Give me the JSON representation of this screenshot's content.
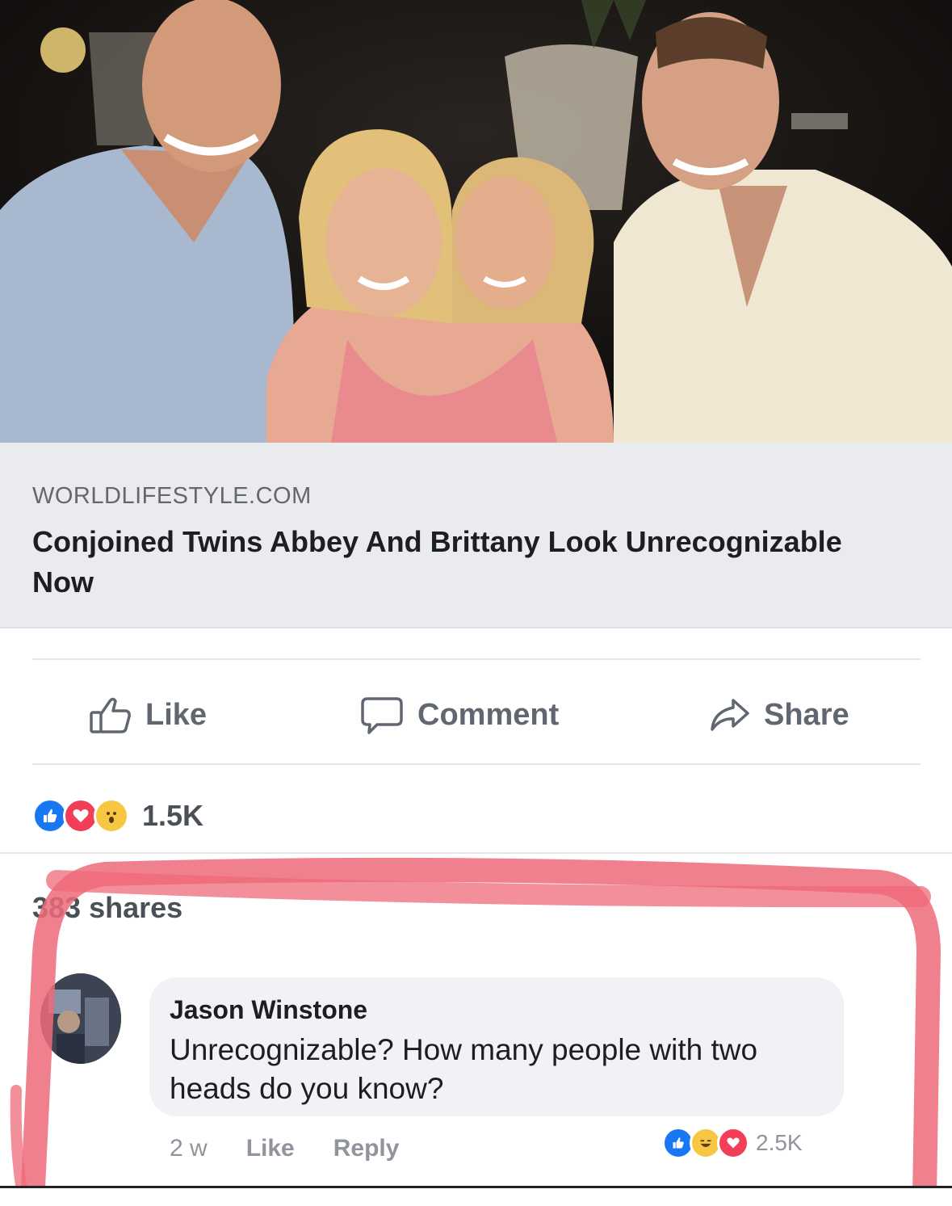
{
  "post": {
    "photo_icon": "group-photo",
    "link_domain": "WORLDLIFESTYLE.COM",
    "link_headline": "Conjoined Twins Abbey And Brittany Look Unrecognizable Now"
  },
  "actions": {
    "like_label": "Like",
    "comment_label": "Comment",
    "share_label": "Share"
  },
  "reactions": {
    "icons": [
      "like-reaction-icon",
      "love-reaction-icon",
      "wow-reaction-icon"
    ],
    "count": "1.5K"
  },
  "shares_text": "383 shares",
  "comment": {
    "author": "Jason Winstone",
    "text": "Unrecognizable? How many people with two heads do you know?",
    "age": "2 w",
    "like_label": "Like",
    "reply_label": "Reply",
    "reaction_count": "2.5K",
    "reaction_icons": [
      "like-reaction-icon",
      "haha-reaction-icon",
      "love-reaction-icon"
    ]
  },
  "colors": {
    "facebook_blue": "#1877f2",
    "love_red": "#f33e58",
    "highlight_pink": "#ee6a7a",
    "link_card_bg": "#e9ebee"
  }
}
